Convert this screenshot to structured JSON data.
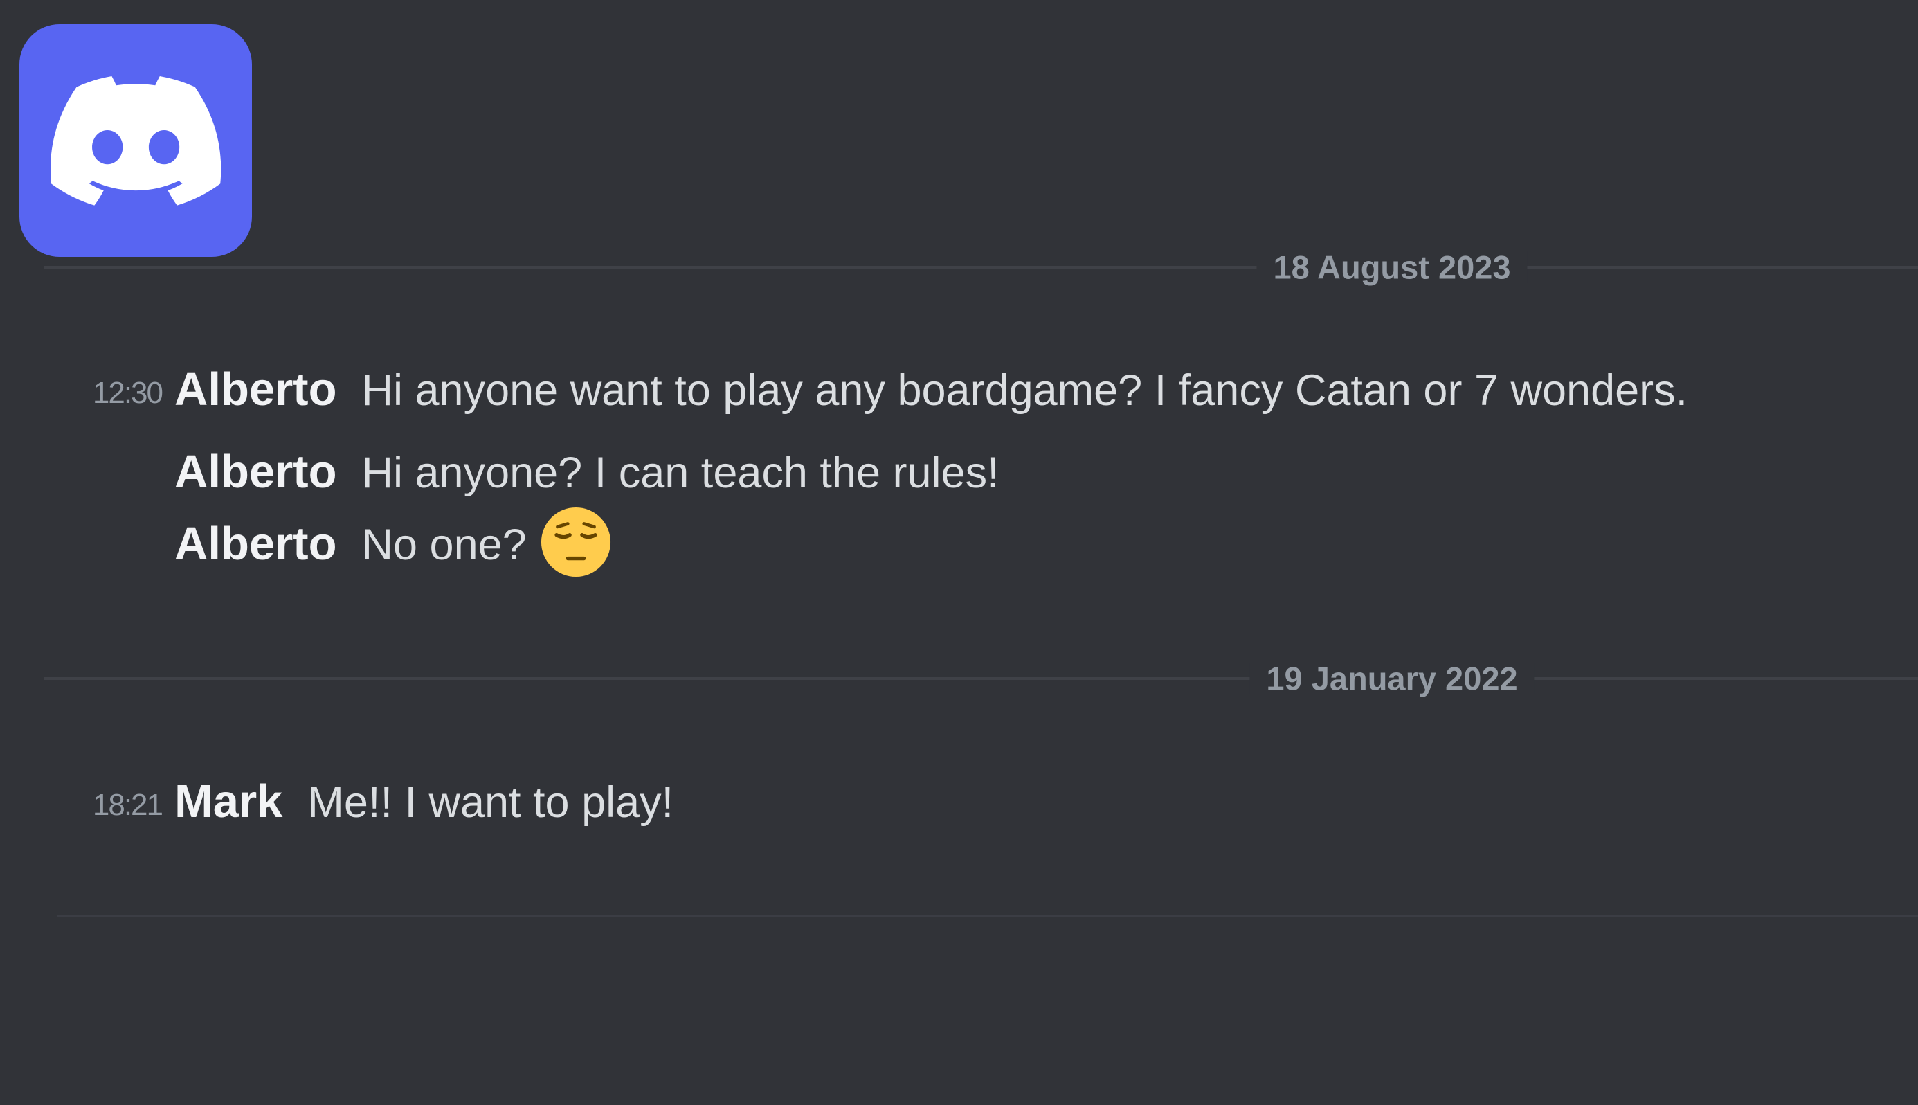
{
  "app": {
    "name": "Discord",
    "brand_color": "#5865F2",
    "logo_icon": "discord-logo-icon"
  },
  "colors": {
    "background": "#313338",
    "divider": "#3f4147",
    "muted_text": "#949ba4",
    "author_text": "#f2f3f5",
    "message_text": "#dbdee1"
  },
  "chat": {
    "dividers": [
      {
        "label": "18 August 2023"
      },
      {
        "label": "19 January 2022"
      }
    ],
    "messages": [
      {
        "time": "12:30",
        "author": "Alberto",
        "text": "Hi anyone want to play any boardgame? I fancy Catan or 7 wonders."
      },
      {
        "time": "",
        "author": "Alberto",
        "text": "Hi anyone? I can teach the rules!"
      },
      {
        "time": "",
        "author": "Alberto",
        "text": "No one?",
        "emoji": "pensive-face-emoji"
      },
      {
        "time": "18:21",
        "author": "Mark",
        "text": "Me!! I want to play!"
      }
    ]
  }
}
